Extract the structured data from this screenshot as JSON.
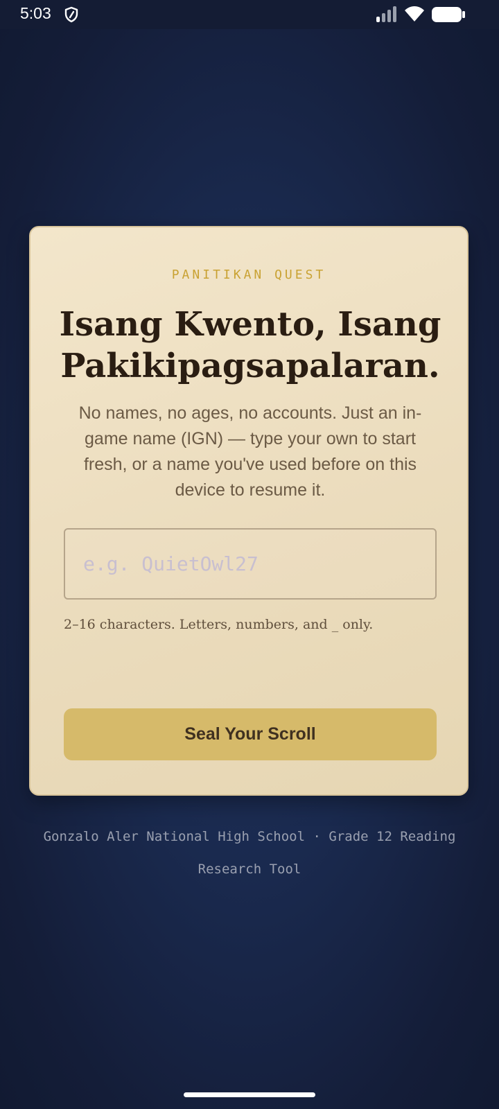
{
  "status_bar": {
    "time": "5:03",
    "icons": [
      "shield-icon",
      "signal-icon",
      "wifi-icon",
      "battery-icon"
    ]
  },
  "card": {
    "eyebrow": "PANITIKAN QUEST",
    "title": "Isang Kwento, Isang Pakikipagsapalaran.",
    "subtitle": "No names, no ages, no accounts. Just an in-game name (IGN) — type your own to start fresh, or a name you've used before on this device to resume it.",
    "ign_input": {
      "value": "",
      "placeholder": "e.g. QuietOwl27"
    },
    "hint": "2–16 characters. Letters, numbers, and _ only.",
    "submit_label": "Seal Your Scroll"
  },
  "footer": {
    "text": "Gonzalo Aler National High School · Grade 12 Reading Research Tool"
  },
  "colors": {
    "background": "#1a2a4f",
    "card": "#efe1c4",
    "accent_gold": "#c9a233",
    "button": "#d6ba6a",
    "title_text": "#2a1d12"
  }
}
